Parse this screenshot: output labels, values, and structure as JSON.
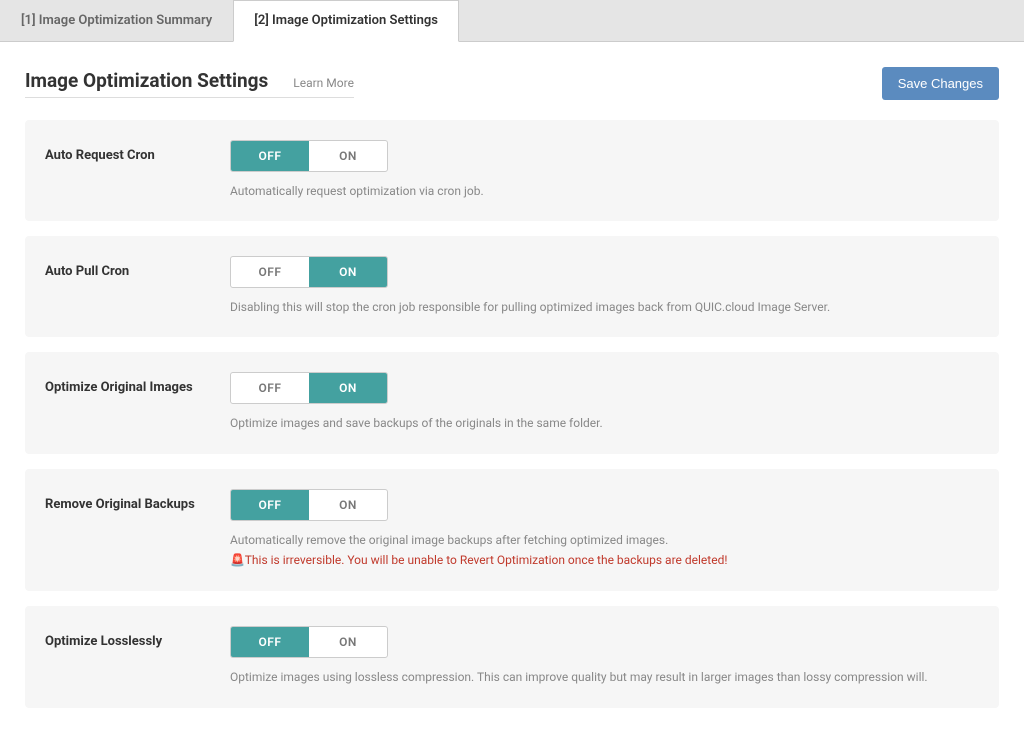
{
  "tabs": [
    {
      "label": "[1] Image Optimization Summary",
      "active": false
    },
    {
      "label": "[2] Image Optimization Settings",
      "active": true
    }
  ],
  "page_title": "Image Optimization Settings",
  "learn_more": "Learn More",
  "save_button": "Save Changes",
  "toggle_labels": {
    "off": "OFF",
    "on": "ON"
  },
  "settings": {
    "auto_request_cron": {
      "label": "Auto Request Cron",
      "value": "off",
      "desc": "Automatically request optimization via cron job."
    },
    "auto_pull_cron": {
      "label": "Auto Pull Cron",
      "value": "on",
      "desc": "Disabling this will stop the cron job responsible for pulling optimized images back from QUIC.cloud Image Server."
    },
    "optimize_original": {
      "label": "Optimize Original Images",
      "value": "on",
      "desc": "Optimize images and save backups of the originals in the same folder."
    },
    "remove_backups": {
      "label": "Remove Original Backups",
      "value": "off",
      "desc": "Automatically remove the original image backups after fetching optimized images.",
      "warning_icon": "🚨",
      "warning": "This is irreversible. You will be unable to Revert Optimization once the backups are deleted!"
    },
    "optimize_losslessly": {
      "label": "Optimize Losslessly",
      "value": "off",
      "desc": "Optimize images using lossless compression. This can improve quality but may result in larger images than lossy compression will."
    }
  }
}
